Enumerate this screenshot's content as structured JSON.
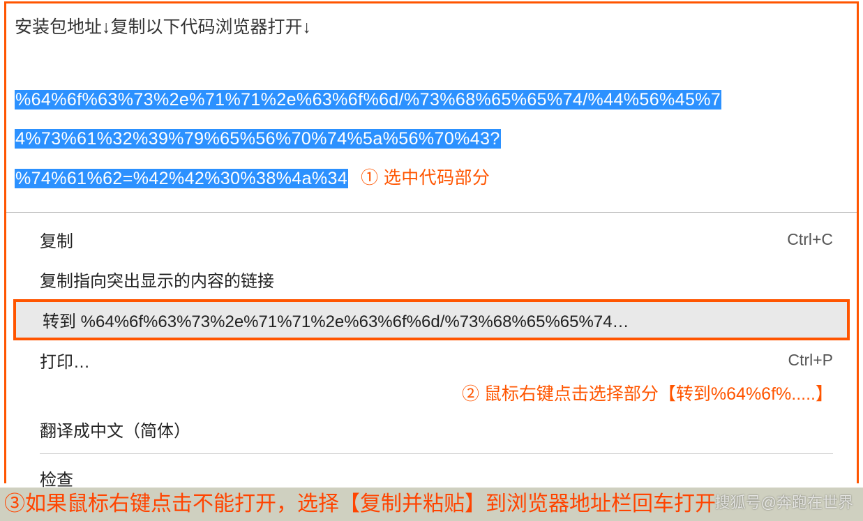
{
  "header": {
    "instruction": "安装包地址↓复制以下代码浏览器打开↓"
  },
  "code": {
    "line1": "%64%6f%63%73%2e%71%71%2e%63%6f%6d/%73%68%65%65%74/%44%56%45%7",
    "line2": "4%73%61%32%39%79%65%56%70%74%5a%56%70%43?",
    "line3": "%74%61%62=%42%42%30%38%4a%34"
  },
  "annotation": {
    "step1": "① 选中代码部分",
    "step2": "② 鼠标右键点击选择部分【转到%64%6f%.....】",
    "step3": "③如果鼠标右键点击不能打开，选择【复制并粘贴】到浏览器地址栏回车打开"
  },
  "menu": {
    "copy": "复制",
    "copy_shortcut": "Ctrl+C",
    "copy_link": "复制指向突出显示的内容的链接",
    "goto": "转到 %64%6f%63%73%2e%71%71%2e%63%6f%6d/%73%68%65%65%74…",
    "print": "打印…",
    "print_shortcut": "Ctrl+P",
    "translate": "翻译成中文（简体）",
    "inspect": "检查"
  },
  "watermark": "搜狐号@奔跑在世界"
}
